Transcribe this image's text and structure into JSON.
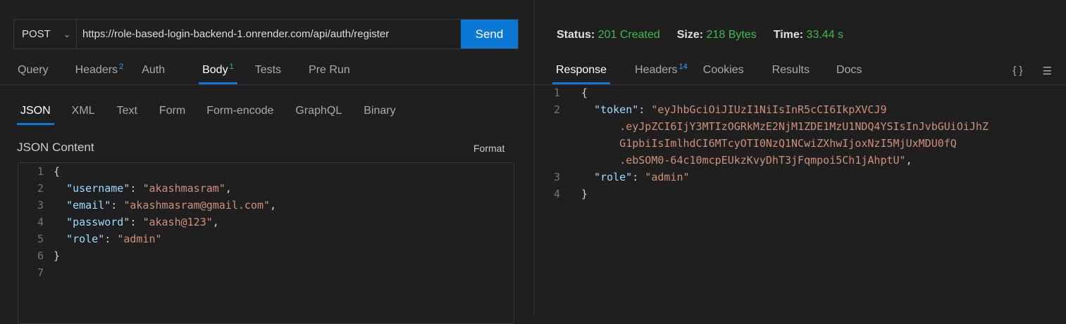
{
  "request": {
    "method": "POST",
    "url": "https://role-based-login-backend-1.onrender.com/api/auth/register",
    "send_label": "Send",
    "tabs": [
      {
        "label": "Query"
      },
      {
        "label": "Headers",
        "badge": "2"
      },
      {
        "label": "Auth"
      },
      {
        "label": "Body",
        "badge": "1"
      },
      {
        "label": "Tests"
      },
      {
        "label": "Pre Run"
      }
    ],
    "body_tabs": [
      "JSON",
      "XML",
      "Text",
      "Form",
      "Form-encode",
      "GraphQL",
      "Binary"
    ],
    "content_title": "JSON Content",
    "format_label": "Format",
    "lines": [
      [
        [
          "p",
          "{"
        ]
      ],
      [
        [
          "p",
          "  "
        ],
        [
          "k",
          "\"username\""
        ],
        [
          "p",
          ": "
        ],
        [
          "s",
          "\"akashmasram\""
        ],
        [
          "p",
          ","
        ]
      ],
      [
        [
          "p",
          "  "
        ],
        [
          "k",
          "\"email\""
        ],
        [
          "p",
          ": "
        ],
        [
          "s",
          "\"akashmasram@gmail.com\""
        ],
        [
          "p",
          ","
        ]
      ],
      [
        [
          "p",
          "  "
        ],
        [
          "k",
          "\"password\""
        ],
        [
          "p",
          ": "
        ],
        [
          "s",
          "\"akash@123\""
        ],
        [
          "p",
          ","
        ]
      ],
      [
        [
          "p",
          "  "
        ],
        [
          "k",
          "\"role\""
        ],
        [
          "p",
          ": "
        ],
        [
          "s",
          "\"admin\""
        ]
      ],
      [
        [
          "p",
          "}"
        ]
      ],
      [
        [
          "p",
          ""
        ]
      ]
    ]
  },
  "response": {
    "status_label": "Status:",
    "status": "201 Created",
    "size_label": "Size:",
    "size": "218 Bytes",
    "time_label": "Time:",
    "time": "33.44 s",
    "tabs": [
      {
        "label": "Response"
      },
      {
        "label": "Headers",
        "badge": "14"
      },
      {
        "label": "Cookies"
      },
      {
        "label": "Results"
      },
      {
        "label": "Docs"
      }
    ],
    "braces_icon": "{ }",
    "lines": [
      {
        "n": "1",
        "segs": [
          [
            "p",
            "{"
          ]
        ]
      },
      {
        "n": "2",
        "segs": [
          [
            "p",
            "  "
          ],
          [
            "k",
            "\"token\""
          ],
          [
            "p",
            ": "
          ],
          [
            "s",
            "\"eyJhbGciOiJIUzI1NiIsInR5cCI6IkpXVCJ9"
          ]
        ]
      },
      {
        "n": "",
        "segs": [
          [
            "s",
            "      .eyJpZCI6IjY3MTIzOGRkMzE2NjM1ZDE1MzU1NDQ4YSIsInJvbGUiOiJhZ"
          ]
        ]
      },
      {
        "n": "",
        "segs": [
          [
            "s",
            "      G1pbiIsImlhdCI6MTcyOTI0NzQ1NCwiZXhwIjoxNzI5MjUxMDU0fQ"
          ]
        ]
      },
      {
        "n": "",
        "segs": [
          [
            "s",
            "      .ebSOM0-64c10mcpEUkzKvyDhT3jFqmpoi5Ch1jAhptU\""
          ],
          [
            "p",
            ","
          ]
        ]
      },
      {
        "n": "3",
        "segs": [
          [
            "p",
            "  "
          ],
          [
            "k",
            "\"role\""
          ],
          [
            "p",
            ": "
          ],
          [
            "s",
            "\"admin\""
          ]
        ]
      },
      {
        "n": "4",
        "segs": [
          [
            "p",
            "}"
          ]
        ]
      }
    ]
  }
}
